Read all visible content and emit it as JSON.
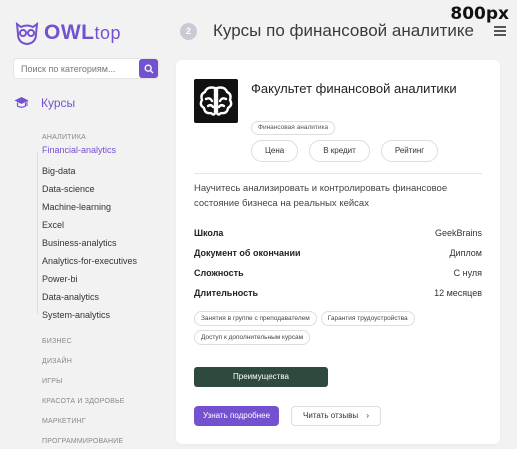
{
  "brand": {
    "owl": "OWL",
    "top": "top",
    "accent": "#7351cf"
  },
  "search": {
    "placeholder": "Поиск по категориям...",
    "icon": "search-icon"
  },
  "sidebar": {
    "courses_label": "Курсы",
    "group_label": "Аналитика",
    "items": [
      "Financial-analytics",
      "Big-data",
      "Data-science",
      "Machine-learning",
      "Excel",
      "Business-analytics",
      "Analytics-for-executives",
      "Power-bi",
      "Data-analytics",
      "System-analytics"
    ],
    "categories": [
      "Бизнес",
      "Дизайн",
      "Игры",
      "Красота и здоровье",
      "Маркетинг",
      "Программирование"
    ]
  },
  "header": {
    "badge": "2",
    "title": "Курсы по финансовой аналитике",
    "corner_label": "800px"
  },
  "course": {
    "title": "Факультет финансовой аналитики",
    "category": "Финансовая аналитика",
    "pills": [
      "Цена",
      "В кредит",
      "Рейтинг"
    ],
    "description": "Научитесь анализировать и контролировать финансовое состояние бизнеса на реальных кейсах",
    "props": [
      {
        "key": "Школа",
        "value": "GeekBrains"
      },
      {
        "key": "Документ об окончании",
        "value": "Диплом"
      },
      {
        "key": "Сложность",
        "value": "С нуля"
      },
      {
        "key": "Длительность",
        "value": "12 месяцев"
      }
    ],
    "tags": [
      "Занятия в группе с преподавателем",
      "Гарантия трудоустройства",
      "Доступ к дополнительным курсам"
    ],
    "advantages_label": "Преимущества",
    "more_label": "Узнать подробнее",
    "reviews_label": "Читать отзывы"
  }
}
